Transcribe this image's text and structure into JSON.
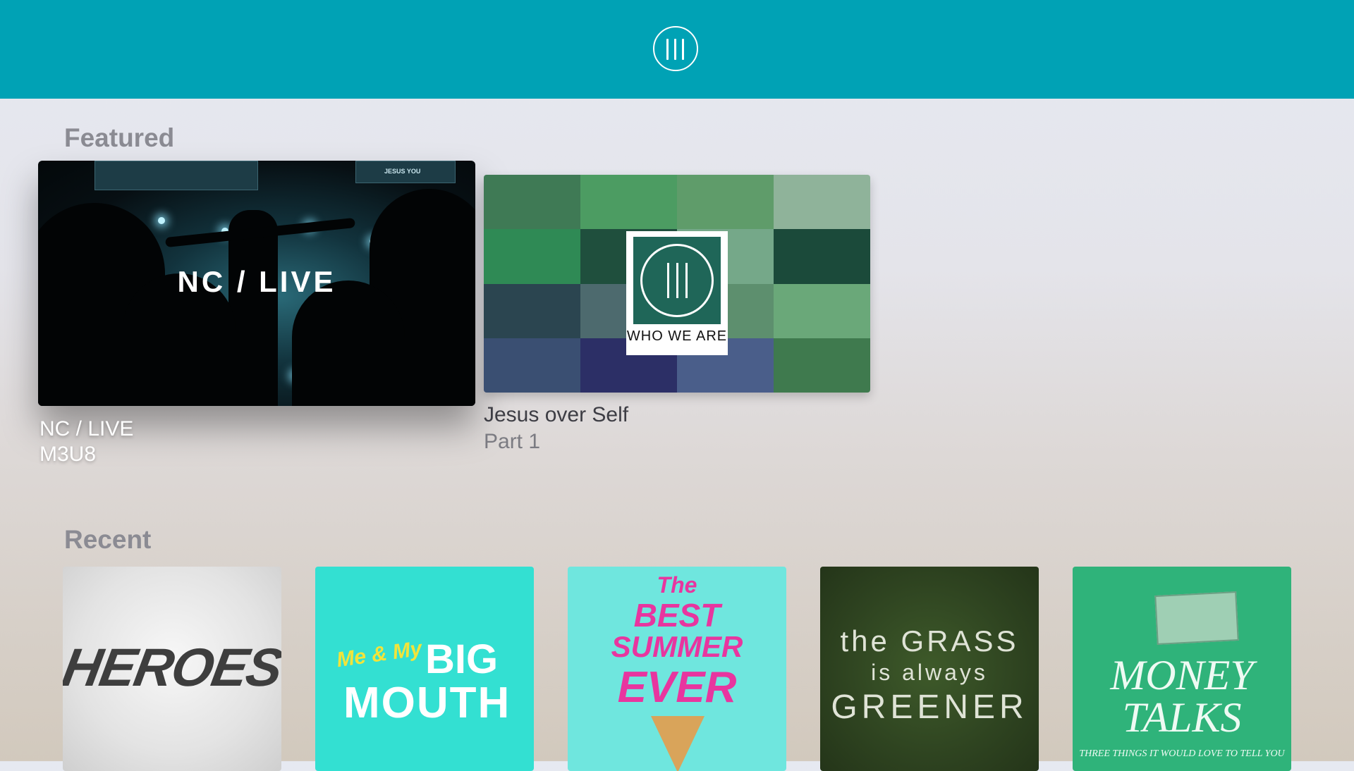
{
  "header": {
    "logo_icon": "church-logo-icon",
    "background": "#00a2b5"
  },
  "featured": {
    "title": "Featured",
    "items": [
      {
        "artwork_text": "NC / LIVE",
        "title": "NC / LIVE",
        "subtitle": "M3U8",
        "focused": true,
        "screen_text": "JESUS YOU"
      },
      {
        "artwork_text": "WHO WE ARE",
        "title": "Jesus over Self",
        "subtitle": "Part 1",
        "focused": false
      }
    ]
  },
  "recent": {
    "title": "Recent",
    "items": [
      {
        "artwork_text": "HEROES"
      },
      {
        "artwork_text_small": "Me & My",
        "artwork_text_big1": "BIG",
        "artwork_text_big2": "MOUTH"
      },
      {
        "artwork_text1": "The",
        "artwork_text2": "BEST",
        "artwork_text3": "SUMMER",
        "artwork_text4": "EVER"
      },
      {
        "artwork_text1": "the GRASS",
        "artwork_text2": "is always",
        "artwork_text3": "GREENER"
      },
      {
        "artwork_text1": "MONEY",
        "artwork_text2": "TALKS",
        "artwork_text3": "THREE THINGS IT WOULD LOVE TO TELL YOU"
      }
    ]
  }
}
